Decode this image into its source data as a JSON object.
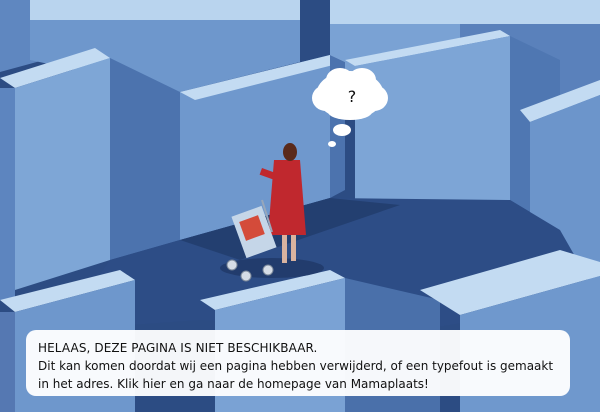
{
  "thought_bubble": {
    "symbol": "?"
  },
  "notice": {
    "heading": "HELAAS, DEZE PAGINA IS NIET BESCHIKBAAR.",
    "line1": "Dit kan komen doordat wij een pagina hebben verwijderd, of een typefout is gemaakt",
    "line2_part1": "in het adres. ",
    "link_text": "Klik hier",
    "line2_part2": " en ga naar de homepage van Mamaplaats!"
  },
  "colors": {
    "wall_top": "#b7d3ee",
    "wall_light": "#7ea6d6",
    "wall_dark": "#3a5e97",
    "floor": "#2e4f86",
    "coat": "#c0282e"
  }
}
